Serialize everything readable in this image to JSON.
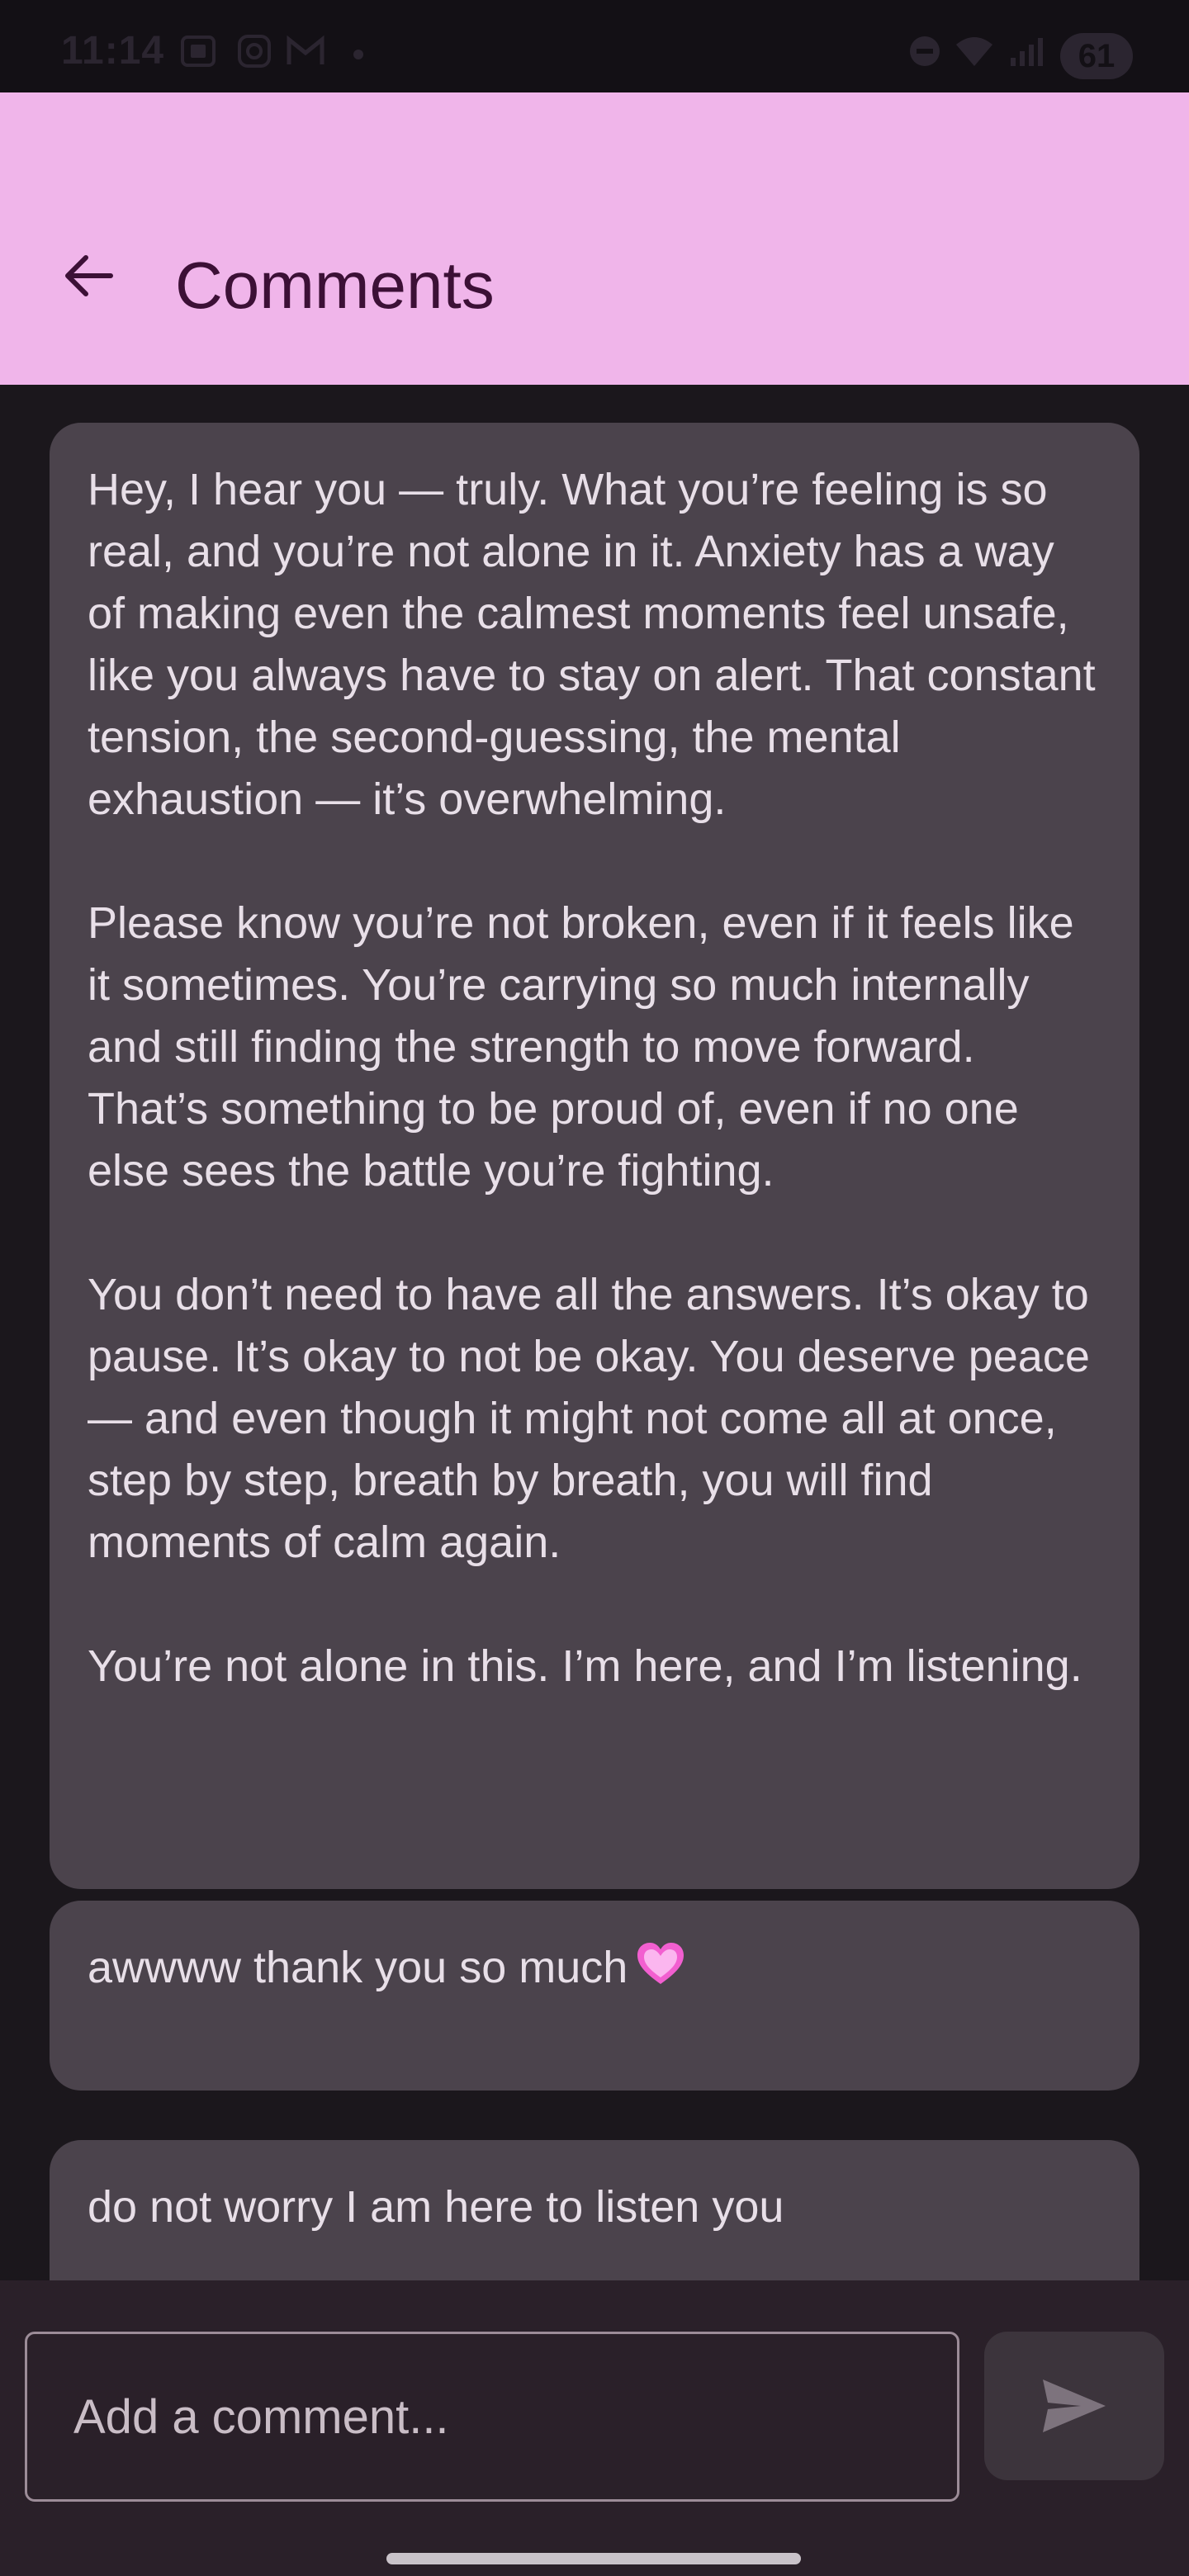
{
  "status_bar": {
    "time": "11:14",
    "battery": "61",
    "icons": [
      "screenshot-icon",
      "instagram-icon",
      "gmail-icon",
      "notification-dot",
      "do-not-disturb-icon",
      "wifi-icon",
      "signal-icon",
      "battery-icon"
    ]
  },
  "header": {
    "title": "Comments",
    "back_icon": "arrow-left-icon",
    "background_color": "#f0b5ea",
    "title_color": "#3c1036"
  },
  "comments": [
    {
      "text": "Hey, I hear you — truly. What you’re feeling is so real, and you’re not alone in it. Anxiety has a way of making even the calmest moments feel unsafe, like you always have to stay on alert. That constant tension, the second-guessing, the mental exhaustion — it’s overwhelming.\n\nPlease know you’re not broken, even if it feels like it sometimes. You’re carrying so much internally and still finding the strength to move forward. That’s something to be proud of, even if no one else sees the battle you’re fighting.\n\nYou don’t need to have all the answers. It’s okay to pause. It’s okay to not be okay. You deserve peace — and even though it might not come all at once, step by step, breath by breath, you will find moments of calm again.\n\nYou’re not alone in this. I’m here, and I’m listening."
    },
    {
      "text": "awwww thank you so much",
      "emoji": "heart-icon"
    },
    {
      "text": "do not worry I am here to listen you"
    }
  ],
  "composer": {
    "placeholder": "Add a comment...",
    "value": "",
    "send_icon": "send-icon"
  },
  "colors": {
    "background": "#1b171c",
    "card": "#4b434c",
    "card_text": "#e8dfe8",
    "composer_bg": "#2a2029"
  }
}
